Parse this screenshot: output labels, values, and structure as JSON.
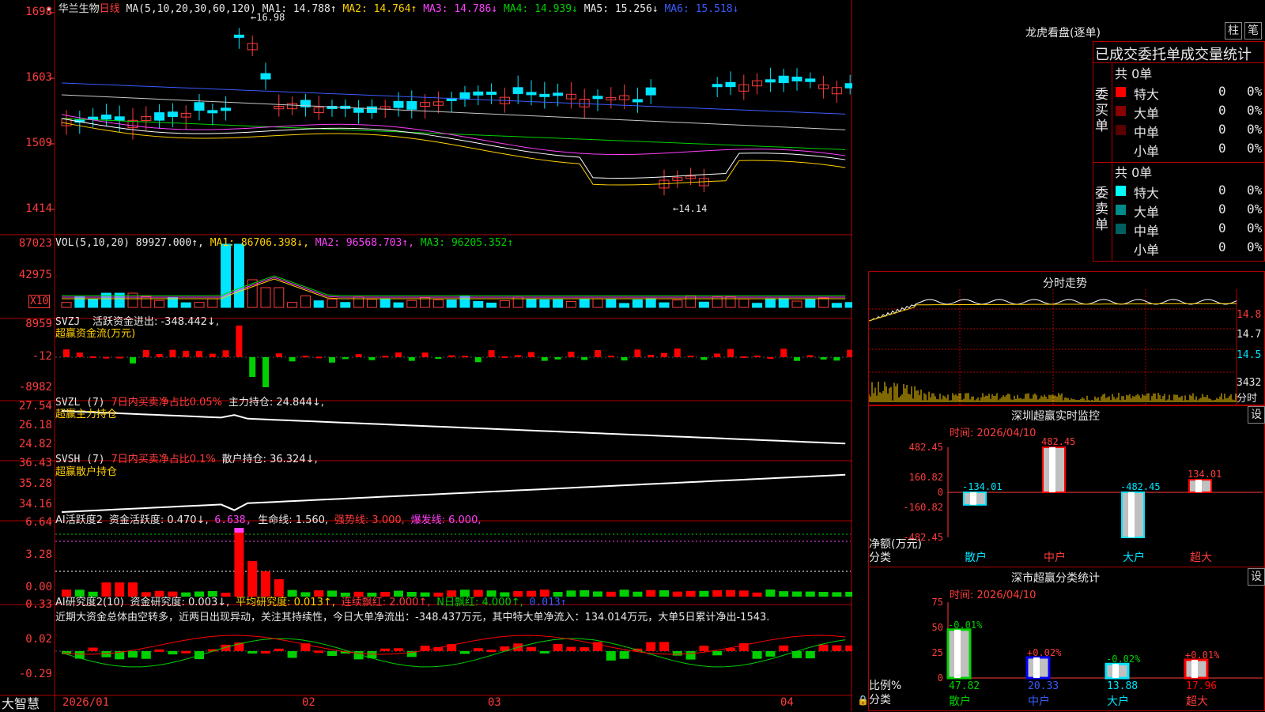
{
  "stock": {
    "name": "华兰生物",
    "period": "日线",
    "ma_label": "MA(5,10,20,30,60,120)"
  },
  "price_header": [
    {
      "text": "MA1: 14.788↑",
      "color": "#e8e8e8"
    },
    {
      "text": "MA2: 14.764↑",
      "color": "#ffd000"
    },
    {
      "text": "MA3: 14.786↓",
      "color": "#ff40ff"
    },
    {
      "text": "MA4: 14.939↓",
      "color": "#00d000"
    },
    {
      "text": "MA5: 15.256↓",
      "color": "#e8e8e8"
    },
    {
      "text": "MA6: 15.518↓",
      "color": "#3a5bff"
    }
  ],
  "price_axis": [
    "1698",
    "1603",
    "1509",
    "1414"
  ],
  "price_hi_label": "16.98",
  "price_lo_label": "14.14",
  "vol_header": {
    "name": "VOL(5,10,20)",
    "value": "89927.000↑",
    "ma1": "MA1: 86706.398↓",
    "ma2": "MA2: 96568.703↑",
    "ma3": "MA3: 96205.352↑"
  },
  "vol_axis": [
    "87023",
    "42975"
  ],
  "vol_unit": "X10",
  "svzj": {
    "name": "SVZJ",
    "label": "活跃资金进出: -348.442↓,",
    "title": "超赢资金流(万元)",
    "axis": [
      "8959",
      "-12",
      "-8982"
    ]
  },
  "svzl": {
    "name": "SVZL (7)",
    "ratio": "7日内买卖净占比0.05%",
    "value": "主力持仓: 24.844↓,",
    "title": "超赢主力持仓",
    "axis": [
      "27.54",
      "26.18",
      "24.82"
    ]
  },
  "svsh": {
    "name": "SVSH (7)",
    "ratio": "7日内买卖净占比0.1%",
    "value": "散户持仓: 36.324↓,",
    "title": "超赢散户持仓",
    "axis": [
      "36.43",
      "35.28",
      "34.16"
    ]
  },
  "ai1": {
    "name": "AI活跃度2",
    "v1": "资金活跃度: 0.470↓,",
    "v2": "6.638,",
    "v3": "生命线: 1.560,",
    "v4": "强势线: 3.000,",
    "v5": "爆发线: 6.000,",
    "axis": [
      "6.64",
      "3.28",
      "0.00"
    ]
  },
  "ai2": {
    "name": "AI研究度2(10)",
    "v1": "资金研究度: 0.003↓,",
    "v2": "平均研究度: 0.013↑,",
    "v3": "连续飘红: 2.000↑,",
    "v4": "N日飘红: 4.000↑,",
    "v5": "0.013↑",
    "comment": "近期大资金总体由空转多，近两日出现异动，关注其持续性，今日大单净流出：-348.437万元，其中特大单净流入：134.014万元，大单5日累计净出-1543.",
    "axis": [
      "0.33",
      "0.02",
      "-0.29"
    ]
  },
  "xaxis": {
    "logo": "大智慧",
    "labels": [
      "2026/01",
      "02",
      "03",
      "04"
    ]
  },
  "dragon": {
    "title": "龙虎看盘(逐单)",
    "btn_zhu": "柱",
    "btn_bi": "笔",
    "stats_title": "已成交委托单成交量统计",
    "buy": {
      "side": "委买单",
      "total": "共 0单",
      "rows": [
        {
          "label": "特大",
          "count": "0",
          "pct": "0%",
          "color": "#ff0000"
        },
        {
          "label": "大单",
          "count": "0",
          "pct": "0%",
          "color": "#8a0000"
        },
        {
          "label": "中单",
          "count": "0",
          "pct": "0%",
          "color": "#5a0000"
        },
        {
          "label": "小单",
          "count": "0",
          "pct": "0%",
          "color": "#000000"
        }
      ]
    },
    "sell": {
      "side": "委卖单",
      "total": "共 0单",
      "rows": [
        {
          "label": "特大",
          "count": "0",
          "pct": "0%",
          "color": "#00ffff"
        },
        {
          "label": "大单",
          "count": "0",
          "pct": "0%",
          "color": "#008b8b"
        },
        {
          "label": "中单",
          "count": "0",
          "pct": "0%",
          "color": "#006060"
        },
        {
          "label": "小单",
          "count": "0",
          "pct": "0%",
          "color": "#000000"
        }
      ]
    }
  },
  "intraday": {
    "title": "分时走势",
    "axis": [
      "14.8",
      "14.7",
      "14.5"
    ],
    "vol": "3432",
    "unit": "分时"
  },
  "sz_monitor": {
    "title": "深圳超赢实时监控",
    "btn": "设",
    "date": "时间: 2026/04/10",
    "axis": [
      "482.45",
      "160.82",
      "0",
      "-160.82",
      "-482.45"
    ],
    "ylabel": "净额(万元)",
    "xlabel": "分类",
    "cats": [
      "散户",
      "中户",
      "大户",
      "超大"
    ],
    "values": [
      -134.01,
      482.45,
      -482.45,
      134.01
    ],
    "labels": [
      "-134.01",
      "482.45",
      "-482.45",
      "134.01"
    ]
  },
  "sz_class": {
    "title": "深市超赢分类统计",
    "btn": "设",
    "date": "时间: 2026/04/10",
    "axis": [
      "75",
      "50",
      "25",
      "0"
    ],
    "ylabel": "比例%",
    "xlabel": "分类",
    "cats": [
      "散户",
      "中户",
      "大户",
      "超大"
    ],
    "values": [
      47.82,
      20.33,
      13.88,
      17.96
    ],
    "changes": [
      "-0.01%",
      "+0.02%",
      "-0.02%",
      "+0.01%"
    ],
    "labels": [
      "47.82",
      "20.33",
      "13.88",
      "17.96"
    ]
  },
  "chart_data": [
    {
      "type": "bar",
      "title": "深圳超赢实时监控",
      "xlabel": "分类",
      "ylabel": "净额(万元)",
      "categories": [
        "散户",
        "中户",
        "大户",
        "超大"
      ],
      "values": [
        -134.01,
        482.45,
        -482.45,
        134.01
      ],
      "ylim": [
        -482.45,
        482.45
      ]
    },
    {
      "type": "bar",
      "title": "深市超赢分类统计",
      "xlabel": "分类",
      "ylabel": "比例%",
      "categories": [
        "散户",
        "中户",
        "大户",
        "超大"
      ],
      "values": [
        47.82,
        20.33,
        13.88,
        17.96
      ],
      "ylim": [
        0,
        75
      ]
    }
  ]
}
